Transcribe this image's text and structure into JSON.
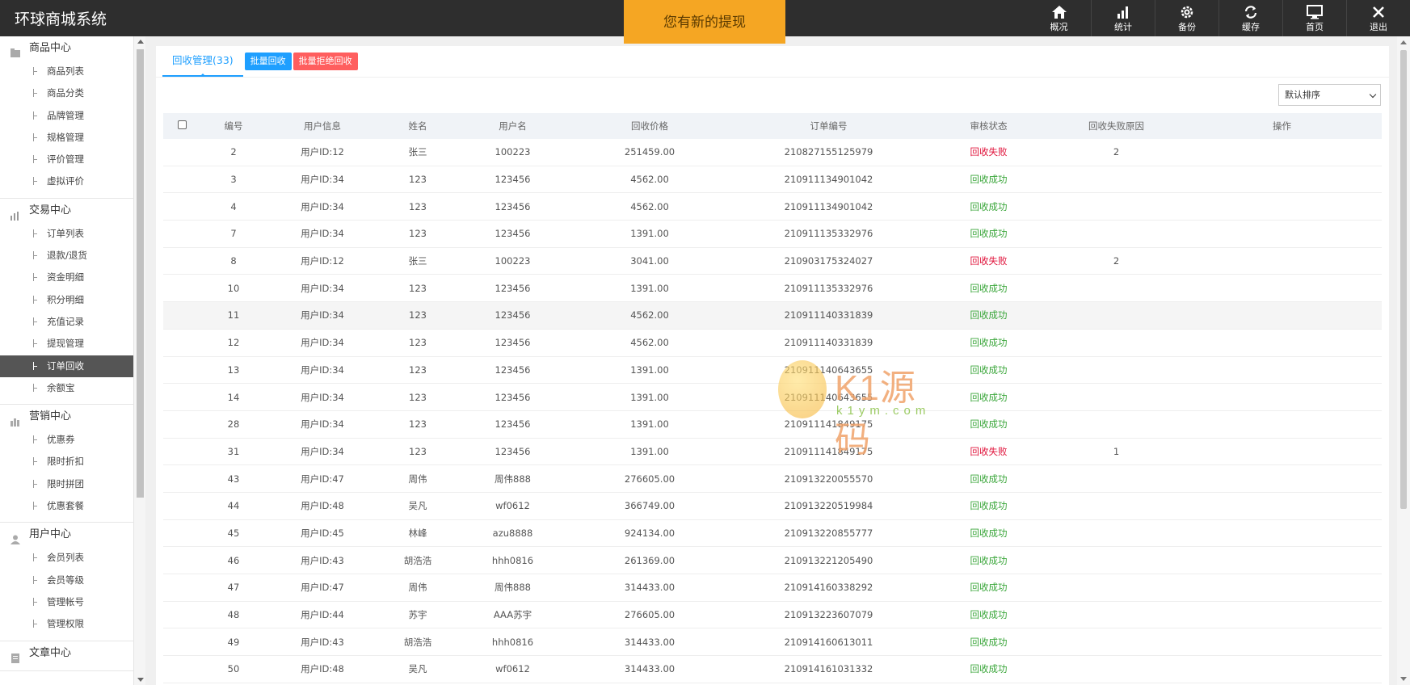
{
  "app": {
    "title": "环球商城系统"
  },
  "notice": {
    "text": "您有新的提现"
  },
  "topnav": [
    {
      "label": "概况",
      "icon": "home-icon"
    },
    {
      "label": "统计",
      "icon": "bar-chart-icon"
    },
    {
      "label": "备份",
      "icon": "gear-icon"
    },
    {
      "label": "缓存",
      "icon": "refresh-icon"
    },
    {
      "label": "首页",
      "icon": "monitor-icon"
    },
    {
      "label": "退出",
      "icon": "close-icon"
    }
  ],
  "sidebar": {
    "groups": [
      {
        "title": "商品中心",
        "icon": "product-icon",
        "items": [
          "商品列表",
          "商品分类",
          "品牌管理",
          "规格管理",
          "评价管理",
          "虚拟评价"
        ]
      },
      {
        "title": "交易中心",
        "icon": "chart-icon",
        "items": [
          "订单列表",
          "退款/退货",
          "资金明细",
          "积分明细",
          "充值记录",
          "提现管理",
          "订单回收",
          "余额宝"
        ],
        "active": "订单回收"
      },
      {
        "title": "营销中心",
        "icon": "marketing-icon",
        "items": [
          "优惠券",
          "限时折扣",
          "限时拼团",
          "优惠套餐"
        ]
      },
      {
        "title": "用户中心",
        "icon": "user-icon",
        "items": [
          "会员列表",
          "会员等级",
          "管理帐号",
          "管理权限"
        ]
      },
      {
        "title": "文章中心",
        "icon": "article-icon",
        "items": []
      }
    ]
  },
  "main": {
    "tab_label": "回收管理(33)",
    "batch_recycle": "批量回收",
    "batch_reject": "批量拒绝回收",
    "sort_select": "默认排序"
  },
  "table": {
    "headers": [
      "编号",
      "用户信息",
      "姓名",
      "用户名",
      "回收价格",
      "订单编号",
      "审核状态",
      "回收失败原因",
      "操作"
    ],
    "rows": [
      [
        "2",
        "用户ID:12",
        "张三",
        "100223",
        "251459.00",
        "210827155125979",
        "回收失败",
        "2",
        ""
      ],
      [
        "3",
        "用户ID:34",
        "123",
        "123456",
        "4562.00",
        "210911134901042",
        "回收成功",
        "",
        ""
      ],
      [
        "4",
        "用户ID:34",
        "123",
        "123456",
        "4562.00",
        "210911134901042",
        "回收成功",
        "",
        ""
      ],
      [
        "7",
        "用户ID:34",
        "123",
        "123456",
        "1391.00",
        "210911135332976",
        "回收成功",
        "",
        ""
      ],
      [
        "8",
        "用户ID:12",
        "张三",
        "100223",
        "3041.00",
        "210903175324027",
        "回收失败",
        "2",
        ""
      ],
      [
        "10",
        "用户ID:34",
        "123",
        "123456",
        "1391.00",
        "210911135332976",
        "回收成功",
        "",
        ""
      ],
      [
        "11",
        "用户ID:34",
        "123",
        "123456",
        "4562.00",
        "210911140331839",
        "回收成功",
        "",
        ""
      ],
      [
        "12",
        "用户ID:34",
        "123",
        "123456",
        "4562.00",
        "210911140331839",
        "回收成功",
        "",
        ""
      ],
      [
        "13",
        "用户ID:34",
        "123",
        "123456",
        "1391.00",
        "210911140643655",
        "回收成功",
        "",
        ""
      ],
      [
        "14",
        "用户ID:34",
        "123",
        "123456",
        "1391.00",
        "210911140643655",
        "回收成功",
        "",
        ""
      ],
      [
        "28",
        "用户ID:34",
        "123",
        "123456",
        "1391.00",
        "210911141849175",
        "回收成功",
        "",
        ""
      ],
      [
        "31",
        "用户ID:34",
        "123",
        "123456",
        "1391.00",
        "210911141849175",
        "回收失败",
        "1",
        ""
      ],
      [
        "43",
        "用户ID:47",
        "周伟",
        "周伟888",
        "276605.00",
        "210913220055570",
        "回收成功",
        "",
        ""
      ],
      [
        "44",
        "用户ID:48",
        "吴凡",
        "wf0612",
        "366749.00",
        "210913220519984",
        "回收成功",
        "",
        ""
      ],
      [
        "45",
        "用户ID:45",
        "林峰",
        "azu8888",
        "924134.00",
        "210913220855777",
        "回收成功",
        "",
        ""
      ],
      [
        "46",
        "用户ID:43",
        "胡浩浩",
        "hhh0816",
        "261369.00",
        "210913221205490",
        "回收成功",
        "",
        ""
      ],
      [
        "47",
        "用户ID:47",
        "周伟",
        "周伟888",
        "314433.00",
        "210914160338292",
        "回收成功",
        "",
        ""
      ],
      [
        "48",
        "用户ID:44",
        "苏宇",
        "AAA苏宇",
        "276605.00",
        "210913223607079",
        "回收成功",
        "",
        ""
      ],
      [
        "49",
        "用户ID:43",
        "胡浩浩",
        "hhh0816",
        "314433.00",
        "210914160613011",
        "回收成功",
        "",
        ""
      ],
      [
        "50",
        "用户ID:48",
        "吴凡",
        "wf0612",
        "314433.00",
        "210914161031332",
        "回收成功",
        "",
        ""
      ]
    ],
    "highlight_row_index": 6
  },
  "watermark": {
    "brand": "K1源码",
    "domain": "k1ym.com"
  },
  "colors": {
    "topbar": "#2e2e2e",
    "notice": "#f5a623",
    "accent": "#1e9fff",
    "danger": "#ff5e5e",
    "fail": "#e0123a",
    "success": "#3aa63a"
  }
}
